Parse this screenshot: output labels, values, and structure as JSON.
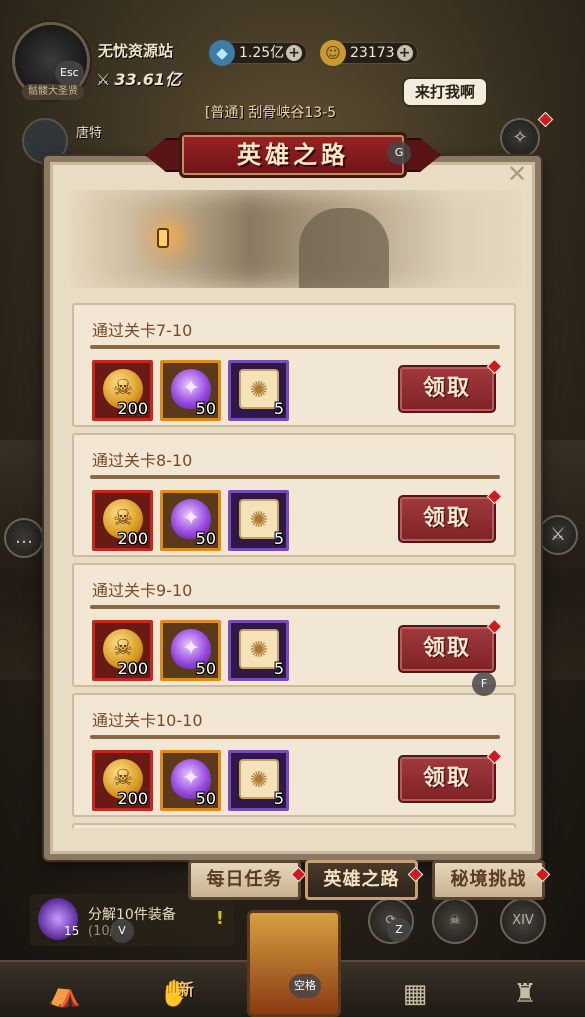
{
  "hud": {
    "player_name": "无忧资源站",
    "power": "33.61亿",
    "rank_label": "骷髅大圣贤",
    "gems": "1.25亿",
    "coins": "23173",
    "stage": "[普通] 刮骨峡谷13-5",
    "speech": "来打我啊",
    "ally_name": "唐特"
  },
  "hotkeys": {
    "esc": "Esc",
    "g": "G",
    "f": "F",
    "v": "V",
    "z": "Z",
    "space": "空格"
  },
  "modal": {
    "title": "英雄之路",
    "close_glyph": "✕",
    "quests": [
      {
        "title": "通过关卡7-10",
        "rewards": [
          {
            "type": "coin",
            "count": "200"
          },
          {
            "type": "soul",
            "count": "50"
          },
          {
            "type": "scroll",
            "count": "5"
          }
        ],
        "button": "领取"
      },
      {
        "title": "通过关卡8-10",
        "rewards": [
          {
            "type": "coin",
            "count": "200"
          },
          {
            "type": "soul",
            "count": "50"
          },
          {
            "type": "scroll",
            "count": "5"
          }
        ],
        "button": "领取"
      },
      {
        "title": "通过关卡9-10",
        "rewards": [
          {
            "type": "coin",
            "count": "200"
          },
          {
            "type": "soul",
            "count": "50"
          },
          {
            "type": "scroll",
            "count": "5"
          }
        ],
        "button": "领取"
      },
      {
        "title": "通过关卡10-10",
        "rewards": [
          {
            "type": "coin",
            "count": "200"
          },
          {
            "type": "soul",
            "count": "50"
          },
          {
            "type": "scroll",
            "count": "5"
          }
        ],
        "button": "领取"
      }
    ],
    "tabs": [
      "每日任务",
      "英雄之路",
      "秘境挑战"
    ],
    "active_tab": 1
  },
  "bottom": {
    "decompose_label": "分解10件装备",
    "decompose_progress": "(10/",
    "decompose_orb_count": "15",
    "nav_new": "新",
    "round_btn_label": "XIV"
  },
  "colors": {
    "accent_red": "#9a2226",
    "parchment": "#f1e7d4",
    "quest_title": "#7a4a28"
  }
}
